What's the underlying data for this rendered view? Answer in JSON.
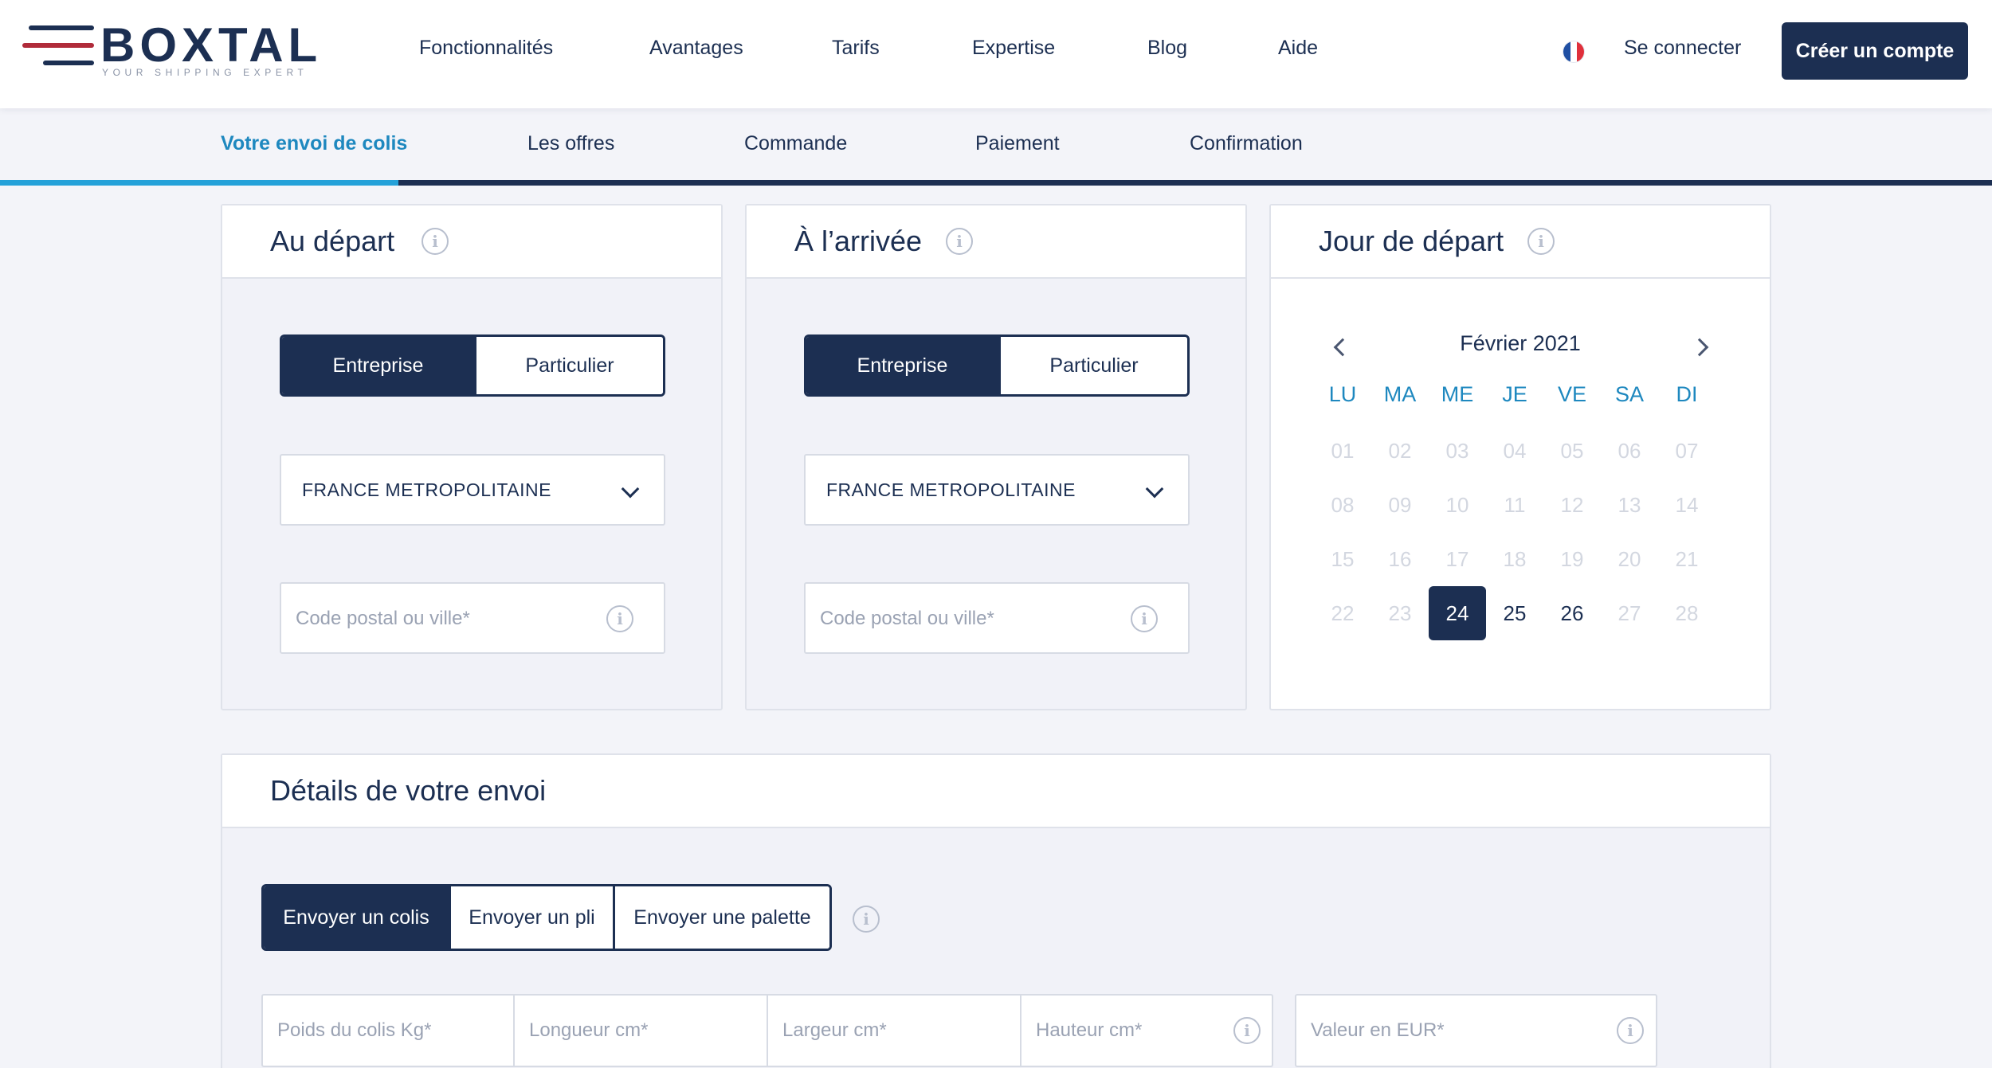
{
  "header": {
    "brand": "BOXTAL",
    "tagline": "YOUR SHIPPING EXPERT",
    "nav": [
      "Fonctionnalités",
      "Avantages",
      "Tarifs",
      "Expertise",
      "Blog",
      "Aide"
    ],
    "flag_icon": "france-flag-icon",
    "login": "Se connecter",
    "create_account": "Créer un compte"
  },
  "steps": {
    "items": [
      "Votre envoi de colis",
      "Les offres",
      "Commande",
      "Paiement",
      "Confirmation"
    ],
    "active_index": 0,
    "progress_fraction": 0.2
  },
  "departure": {
    "title": "Au départ",
    "toggle": [
      "Entreprise",
      "Particulier"
    ],
    "selected": "Entreprise",
    "country": "FRANCE METROPOLITAINE",
    "postal_placeholder": "Code postal ou ville*"
  },
  "arrival": {
    "title": "À l’arrivée",
    "toggle": [
      "Entreprise",
      "Particulier"
    ],
    "selected": "Entreprise",
    "country": "FRANCE METROPOLITAINE",
    "postal_placeholder": "Code postal ou ville*"
  },
  "calendar": {
    "title": "Jour de départ",
    "month": "Février 2021",
    "weekdays": [
      "LU",
      "MA",
      "ME",
      "JE",
      "VE",
      "SA",
      "DI"
    ],
    "weeks": [
      [
        "01",
        "02",
        "03",
        "04",
        "05",
        "06",
        "07"
      ],
      [
        "08",
        "09",
        "10",
        "11",
        "12",
        "13",
        "14"
      ],
      [
        "15",
        "16",
        "17",
        "18",
        "19",
        "20",
        "21"
      ],
      [
        "22",
        "23",
        "24",
        "25",
        "26",
        "27",
        "28"
      ]
    ],
    "available": [
      "24",
      "25",
      "26"
    ],
    "selected": "24"
  },
  "details": {
    "title": "Détails de votre envoi",
    "types": [
      "Envoyer un colis",
      "Envoyer un pli",
      "Envoyer une palette"
    ],
    "selected": "Envoyer un colis",
    "weight_placeholder": "Poids du colis Kg*",
    "length_placeholder": "Longueur cm*",
    "width_placeholder": "Largeur cm*",
    "height_placeholder": "Hauteur cm*",
    "value_placeholder": "Valeur en EUR*"
  },
  "colors": {
    "navy": "#1c2f52",
    "accent_blue": "#1e88bf",
    "progress": "#24a1d9",
    "brand_red": "#b02b3a",
    "flag_blue": "#1f4fa3",
    "flag_white": "#ffffff",
    "flag_red": "#e0303b"
  }
}
